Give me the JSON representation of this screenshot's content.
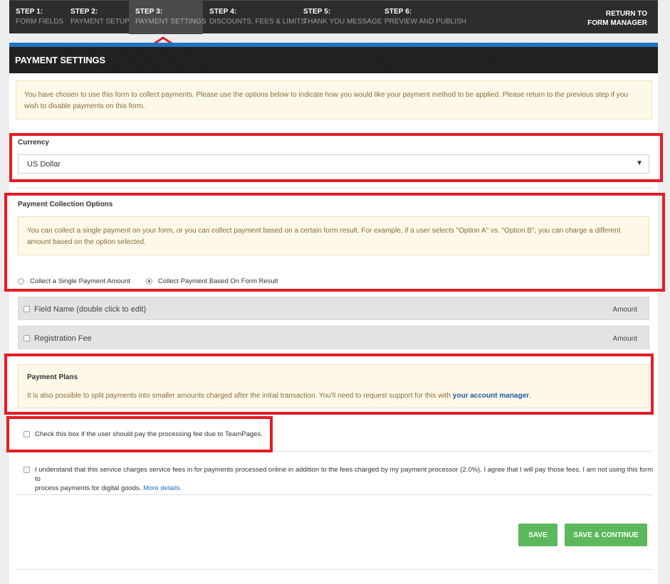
{
  "steps": [
    {
      "num": "STEP 1:",
      "label": "FORM FIELDS"
    },
    {
      "num": "STEP 2:",
      "label": "PAYMENT SETUP"
    },
    {
      "num": "STEP 3:",
      "label": "PAYMENT SETTINGS"
    },
    {
      "num": "STEP 4:",
      "label": "DISCOUNTS, FEES & LIMITS"
    },
    {
      "num": "STEP 5:",
      "label": "THANK YOU MESSAGE"
    },
    {
      "num": "STEP 6:",
      "label": "PREVIEW AND PUBLISH"
    }
  ],
  "return_link": "RETURN TO FORM MANAGER",
  "section_title": "PAYMENT SETTINGS",
  "intro_notice": "You have chosen to use this form to collect payments. Please use the options below to indicate how you would like your payment method to be applied. Please return to the previous step if you wish to disable payments on this form.",
  "currency": {
    "label": "Currency",
    "value": "US Dollar"
  },
  "collection": {
    "label": "Payment Collection Options",
    "notice": "You can collect a single payment on your form, or you can collect payment based on a certain form result. For example, if a user selects \"Option A\" vs. \"Option B\", you can charge a different amount based on the option selected.",
    "option_single": "Collect a Single Payment Amount",
    "option_result": "Collect Payment Based On Form Result"
  },
  "fields": [
    {
      "name": "Field Name (double click to edit)",
      "amount_label": "Amount"
    },
    {
      "name": "Registration Fee",
      "amount_label": "Amount"
    }
  ],
  "payment_plans": {
    "title": "Payment Plans",
    "text": "It is also possible to split payments into smaller amounts charged after the initial transaction. You'll need to request support for this with ",
    "link": "your account manager",
    "after": "."
  },
  "processing_fee_text": "Check this box if the user should pay the processing fee due to TeamPages.",
  "terms": {
    "line1": "I understand that this service charges service fees in for payments processed online in addition to the fees charged by my payment processor (2.0%). I agree that I will pay those fees. I am not using this form to",
    "line2": "process payments for digital goods. ",
    "link": "More details."
  },
  "buttons": {
    "save": "SAVE",
    "save_continue": "SAVE & CONTINUE"
  },
  "colors": {
    "accent_blue": "#1e73be",
    "button_green": "#5cb85c",
    "annotation_red": "#e21d25",
    "notice_bg": "#fdf8e7"
  }
}
